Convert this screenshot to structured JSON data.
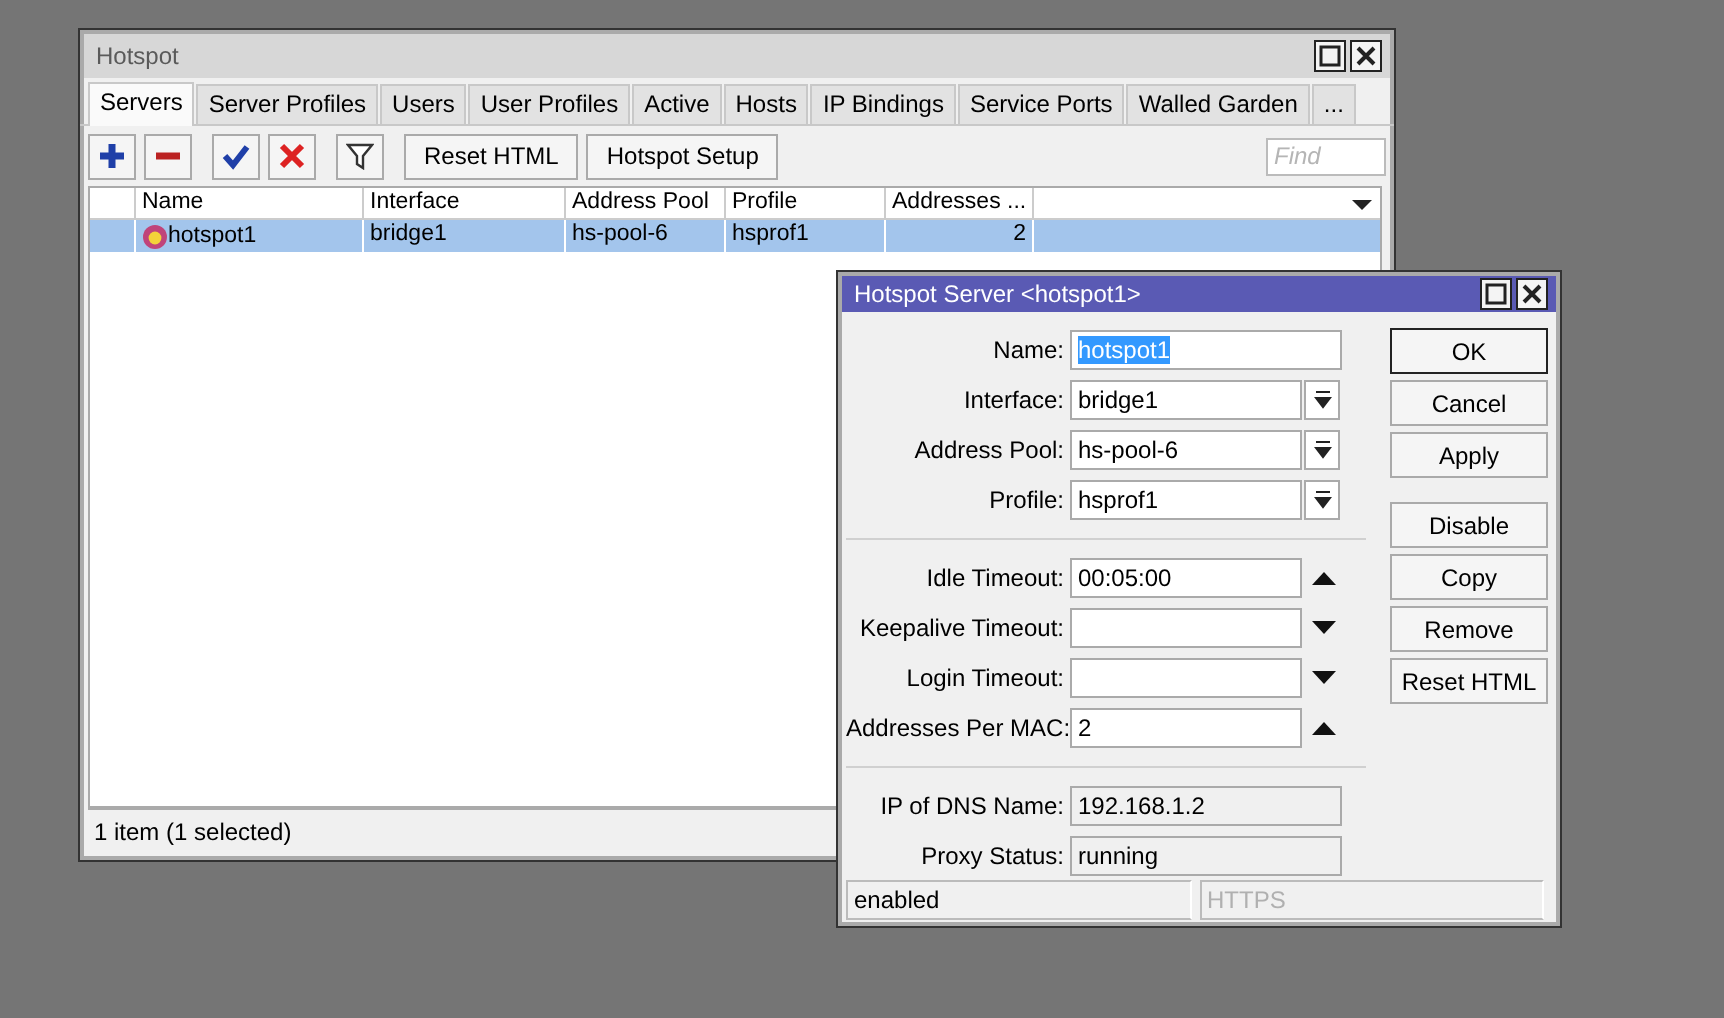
{
  "main_window": {
    "title": "Hotspot",
    "tabs": [
      {
        "label": "Servers",
        "selected": true
      },
      {
        "label": "Server Profiles",
        "selected": false
      },
      {
        "label": "Users",
        "selected": false
      },
      {
        "label": "User Profiles",
        "selected": false
      },
      {
        "label": "Active",
        "selected": false
      },
      {
        "label": "Hosts",
        "selected": false
      },
      {
        "label": "IP Bindings",
        "selected": false
      },
      {
        "label": "Service Ports",
        "selected": false
      },
      {
        "label": "Walled Garden",
        "selected": false
      },
      {
        "label": "...",
        "selected": false
      }
    ],
    "icon_buttons": [
      {
        "kind": "add"
      },
      {
        "kind": "remove"
      },
      {
        "kind": "enable"
      },
      {
        "kind": "disable"
      },
      {
        "kind": "filter"
      }
    ],
    "text_buttons": [
      "Reset HTML",
      "Hotspot Setup"
    ],
    "search": {
      "placeholder": "Find"
    },
    "table": {
      "columns": [
        "Name",
        "Interface",
        "Address Pool",
        "Profile",
        "Addresses ..."
      ],
      "rows": [
        {
          "cells": [
            "hotspot1",
            "bridge1",
            "hs-pool-6",
            "hsprof1",
            "2"
          ],
          "selected": true
        }
      ]
    },
    "status_bar": "1 item (1 selected)"
  },
  "dialog": {
    "title": "Hotspot Server <hotspot1>",
    "sections": [
      [
        {
          "label": "Name:",
          "value": "hotspot1",
          "kind": "text",
          "text_selected": true
        },
        {
          "label": "Interface:",
          "value": "bridge1",
          "kind": "select",
          "text_selected": false
        },
        {
          "label": "Address Pool:",
          "value": "hs-pool-6",
          "kind": "select",
          "text_selected": false
        },
        {
          "label": "Profile:",
          "value": "hsprof1",
          "kind": "select",
          "text_selected": false
        }
      ],
      [
        {
          "label": "Idle Timeout:",
          "value": "00:05:00",
          "kind": "spin",
          "expanded": true,
          "text_selected": false
        },
        {
          "label": "Keepalive Timeout:",
          "kind": "spin",
          "expanded": false
        },
        {
          "label": "Login Timeout:",
          "kind": "spin",
          "expanded": false
        },
        {
          "label": "Addresses Per MAC:",
          "value": "2",
          "kind": "spin",
          "expanded": true,
          "text_selected": false
        }
      ],
      [
        {
          "label": "IP of DNS Name:",
          "value": "192.168.1.2",
          "kind": "readonly",
          "text_selected": false
        },
        {
          "label": "Proxy Status:",
          "value": "running",
          "kind": "readonly",
          "text_selected": false
        }
      ]
    ],
    "button_groups": [
      [
        {
          "label": "OK",
          "focused": true
        },
        {
          "label": "Cancel",
          "focused": false
        },
        {
          "label": "Apply",
          "focused": false
        }
      ],
      [
        {
          "label": "Disable",
          "focused": false
        },
        {
          "label": "Copy",
          "focused": false
        },
        {
          "label": "Remove",
          "focused": false
        },
        {
          "label": "Reset HTML",
          "focused": false
        }
      ]
    ],
    "status_bar": [
      {
        "text": "enabled",
        "disabled": false
      },
      {
        "text": "HTTPS",
        "disabled": true
      }
    ]
  }
}
